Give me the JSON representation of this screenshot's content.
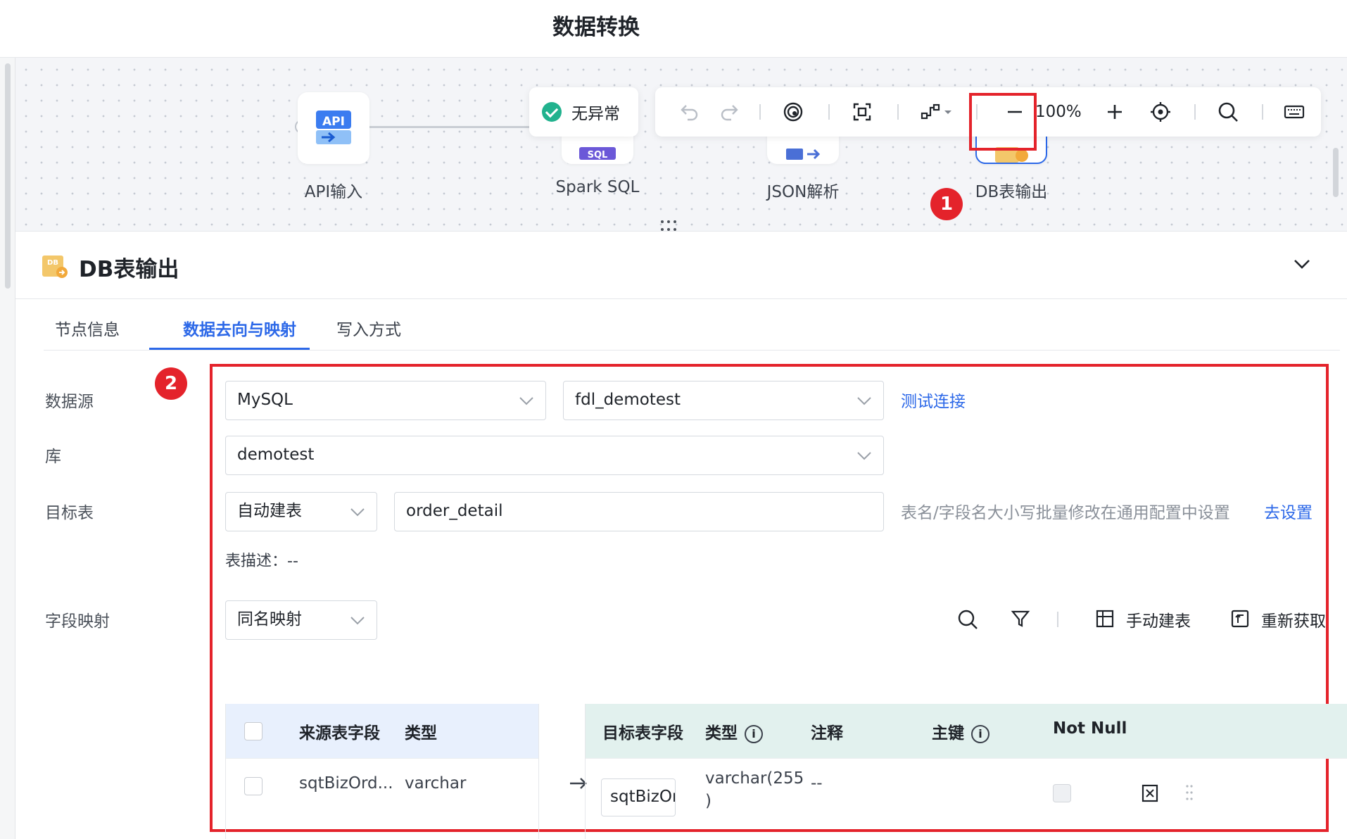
{
  "header": {
    "title": "数据转换"
  },
  "canvas": {
    "nodes": [
      {
        "label": "API输入",
        "icon": "api-icon"
      },
      {
        "label": "Spark SQL",
        "icon": "spark-sql-icon"
      },
      {
        "label": "JSON解析",
        "icon": "json-parse-icon"
      },
      {
        "label": "DB表输出",
        "icon": "db-output-icon"
      }
    ],
    "status": "无异常",
    "toolbar": {
      "zoom": "100%",
      "icons": [
        "undo-icon",
        "redo-icon",
        "preview-icon",
        "fit-screen-icon",
        "layout-icon",
        "zoom-out-icon",
        "zoom-in-icon",
        "locate-icon",
        "search-icon",
        "keyboard-icon"
      ]
    },
    "annotations": [
      "1",
      "2"
    ]
  },
  "panel": {
    "title": "DB表输出",
    "tabs": [
      {
        "label": "节点信息",
        "active": false
      },
      {
        "label": "数据去向与映射",
        "active": true
      },
      {
        "label": "写入方式",
        "active": false
      }
    ],
    "form": {
      "datasource_label": "数据源",
      "datasource_type": "MySQL",
      "datasource_conn": "fdl_demotest",
      "test_link": "测试连接",
      "db_label": "库",
      "db_value": "demotest",
      "target_label": "目标表",
      "target_mode": "自动建表",
      "target_name": "order_detail",
      "target_hint": "表名/字段名大小写批量修改在通用配置中设置",
      "goto_settings": "去设置",
      "table_desc": "表描述：--",
      "mapping_label": "字段映射",
      "mapping_mode": "同名映射",
      "manual_create": "手动建表",
      "refetch": "重新获取"
    },
    "table": {
      "source_headers": [
        "来源表字段",
        "类型"
      ],
      "target_headers": [
        "目标表字段",
        "类型",
        "注释",
        "主键",
        "Not Null"
      ],
      "rows": [
        {
          "source_field": "sqtBizOrd...",
          "source_type": "varchar",
          "target_field": "sqtBizOr",
          "target_type_line1": "varchar(255",
          "target_type_line2": ")",
          "comment": "--"
        }
      ]
    }
  },
  "colors": {
    "accent": "#2c68e8",
    "highlight": "#e4232b",
    "success": "#21b28e"
  }
}
